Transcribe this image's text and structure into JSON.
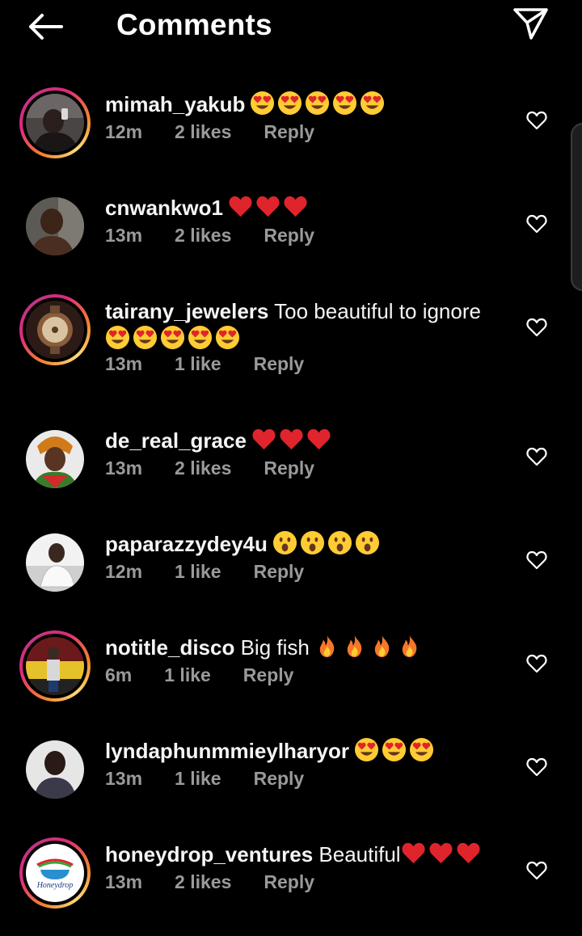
{
  "header": {
    "title": "Comments",
    "back_icon": "arrow-left-icon",
    "share_icon": "paper-plane-icon"
  },
  "colors": {
    "background": "#000000",
    "text": "#ffffff",
    "meta": "#9a9a9a",
    "heart_red": "#e0242b",
    "emoji_yellow": "#ffcc33"
  },
  "comments": [
    {
      "username": "mimah_yakub",
      "text": "",
      "emoji": [
        "heart-eyes",
        "heart-eyes",
        "heart-eyes",
        "heart-eyes",
        "heart-eyes"
      ],
      "time": "12m",
      "likes": "2 likes",
      "reply": "Reply",
      "story_ring": true
    },
    {
      "username": "cnwankwo1",
      "text": "",
      "emoji": [
        "red-heart",
        "red-heart",
        "red-heart"
      ],
      "time": "13m",
      "likes": "2 likes",
      "reply": "Reply",
      "story_ring": false
    },
    {
      "username": "tairany_jewelers",
      "text": "Too beautiful to ignore",
      "emoji": [
        "heart-eyes",
        "heart-eyes",
        "heart-eyes",
        "heart-eyes",
        "heart-eyes"
      ],
      "time": "13m",
      "likes": "1 like",
      "reply": "Reply",
      "story_ring": true
    },
    {
      "username": "de_real_grace",
      "text": "",
      "emoji": [
        "red-heart",
        "red-heart",
        "red-heart"
      ],
      "time": "13m",
      "likes": "2 likes",
      "reply": "Reply",
      "story_ring": false
    },
    {
      "username": "paparazzydey4u",
      "text": "",
      "emoji": [
        "astonished",
        "astonished",
        "astonished",
        "astonished"
      ],
      "time": "12m",
      "likes": "1 like",
      "reply": "Reply",
      "story_ring": false
    },
    {
      "username": "notitle_disco",
      "text": "Big fish",
      "emoji": [
        "fire",
        "fire",
        "fire",
        "fire"
      ],
      "time": "6m",
      "likes": "1 like",
      "reply": "Reply",
      "story_ring": true
    },
    {
      "username": "lyndaphunmmieylharyor",
      "text": "",
      "emoji": [
        "heart-eyes",
        "heart-eyes",
        "heart-eyes"
      ],
      "time": "13m",
      "likes": "1 like",
      "reply": "Reply",
      "story_ring": false
    },
    {
      "username": "honeydrop_ventures",
      "text": "Beautiful",
      "emoji": [
        "red-heart",
        "red-heart",
        "red-heart"
      ],
      "time": "13m",
      "likes": "2 likes",
      "reply": "Reply",
      "story_ring": true,
      "avatar_logo_text": "Honeydrop"
    }
  ]
}
